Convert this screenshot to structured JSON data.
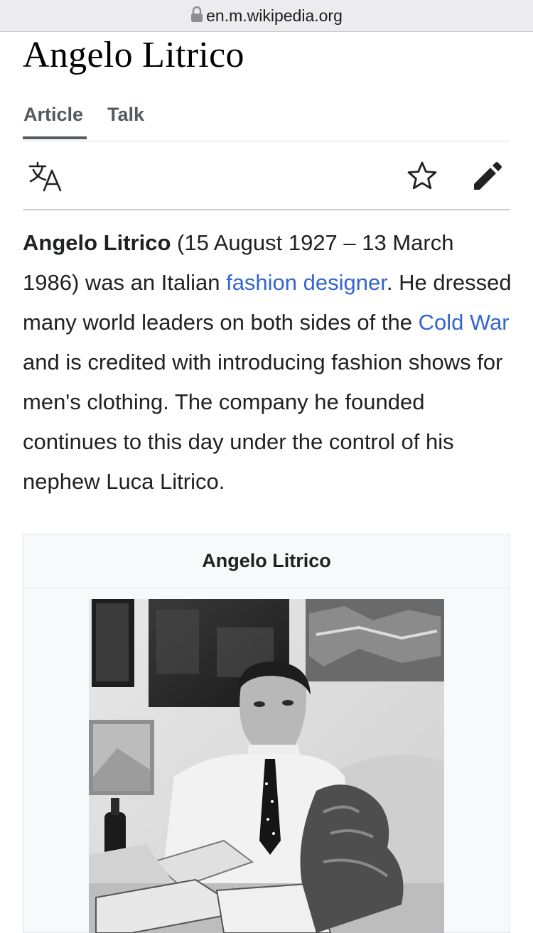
{
  "browser": {
    "url": "en.m.wikipedia.org",
    "lock_icon": "lock-icon"
  },
  "page": {
    "title": "Angelo Litrico"
  },
  "tabs": [
    {
      "label": "Article",
      "active": true
    },
    {
      "label": "Talk",
      "active": false
    }
  ],
  "toolbar": {
    "language_icon": "language-icon",
    "watch_icon": "star-icon",
    "edit_icon": "pencil-icon"
  },
  "lead": {
    "subject": "Angelo Litrico",
    "seg1": " (15 August 1927 – 13 March 1986) was an Italian ",
    "link1": "fashion designer",
    "seg2": ". He dressed many world leaders on both sides of the ",
    "link2": "Cold War",
    "seg3": " and is credited with introducing fashion shows for men's clothing. The company he founded continues to this day under the control of his nephew Luca Litrico."
  },
  "infobox": {
    "title": "Angelo Litrico"
  },
  "colors": {
    "link": "#3366cc",
    "text": "#202122",
    "tab_text": "#54595d"
  }
}
